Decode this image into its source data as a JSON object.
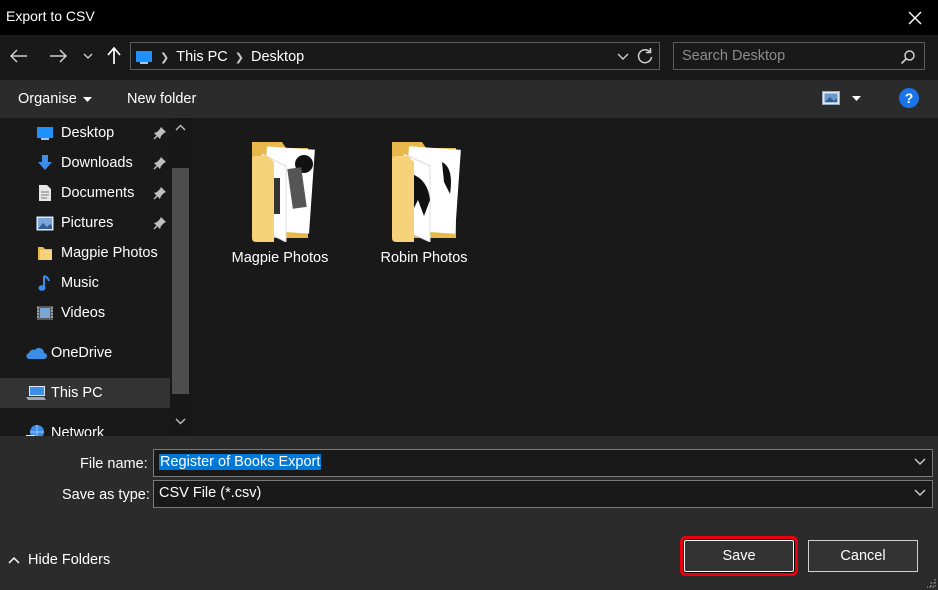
{
  "window": {
    "title": "Export to CSV"
  },
  "address": {
    "segments": [
      "This PC",
      "Desktop"
    ]
  },
  "search": {
    "placeholder": "Search Desktop"
  },
  "toolbar": {
    "organise_label": "Organise",
    "new_folder_label": "New folder"
  },
  "navpane": {
    "items": [
      {
        "label": "Desktop",
        "icon": "desktop-icon",
        "pinned": true
      },
      {
        "label": "Downloads",
        "icon": "downloads-icon",
        "pinned": true
      },
      {
        "label": "Documents",
        "icon": "documents-icon",
        "pinned": true
      },
      {
        "label": "Pictures",
        "icon": "pictures-icon",
        "pinned": true
      },
      {
        "label": "Magpie Photos",
        "icon": "folder-icon",
        "pinned": false
      },
      {
        "label": "Music",
        "icon": "music-icon",
        "pinned": false
      },
      {
        "label": "Videos",
        "icon": "videos-icon",
        "pinned": false
      },
      {
        "label": "OneDrive",
        "icon": "onedrive-icon",
        "pinned": false
      },
      {
        "label": "This PC",
        "icon": "this-pc-icon",
        "pinned": false,
        "selected": true
      },
      {
        "label": "Network",
        "icon": "network-icon",
        "pinned": false
      }
    ]
  },
  "folders": [
    {
      "label": "Magpie Photos"
    },
    {
      "label": "Robin Photos"
    }
  ],
  "form": {
    "file_name_label": "File name:",
    "file_name_value": "Register of Books Export",
    "save_type_label": "Save as type:",
    "save_type_value": "CSV File (*.csv)"
  },
  "actions": {
    "hide_folders_label": "Hide Folders",
    "save_label": "Save",
    "cancel_label": "Cancel"
  },
  "colors": {
    "accent": "#0078d7",
    "highlight_ring": "#e8000c",
    "help": "#1a73e8",
    "folder": "#f6d27a"
  }
}
